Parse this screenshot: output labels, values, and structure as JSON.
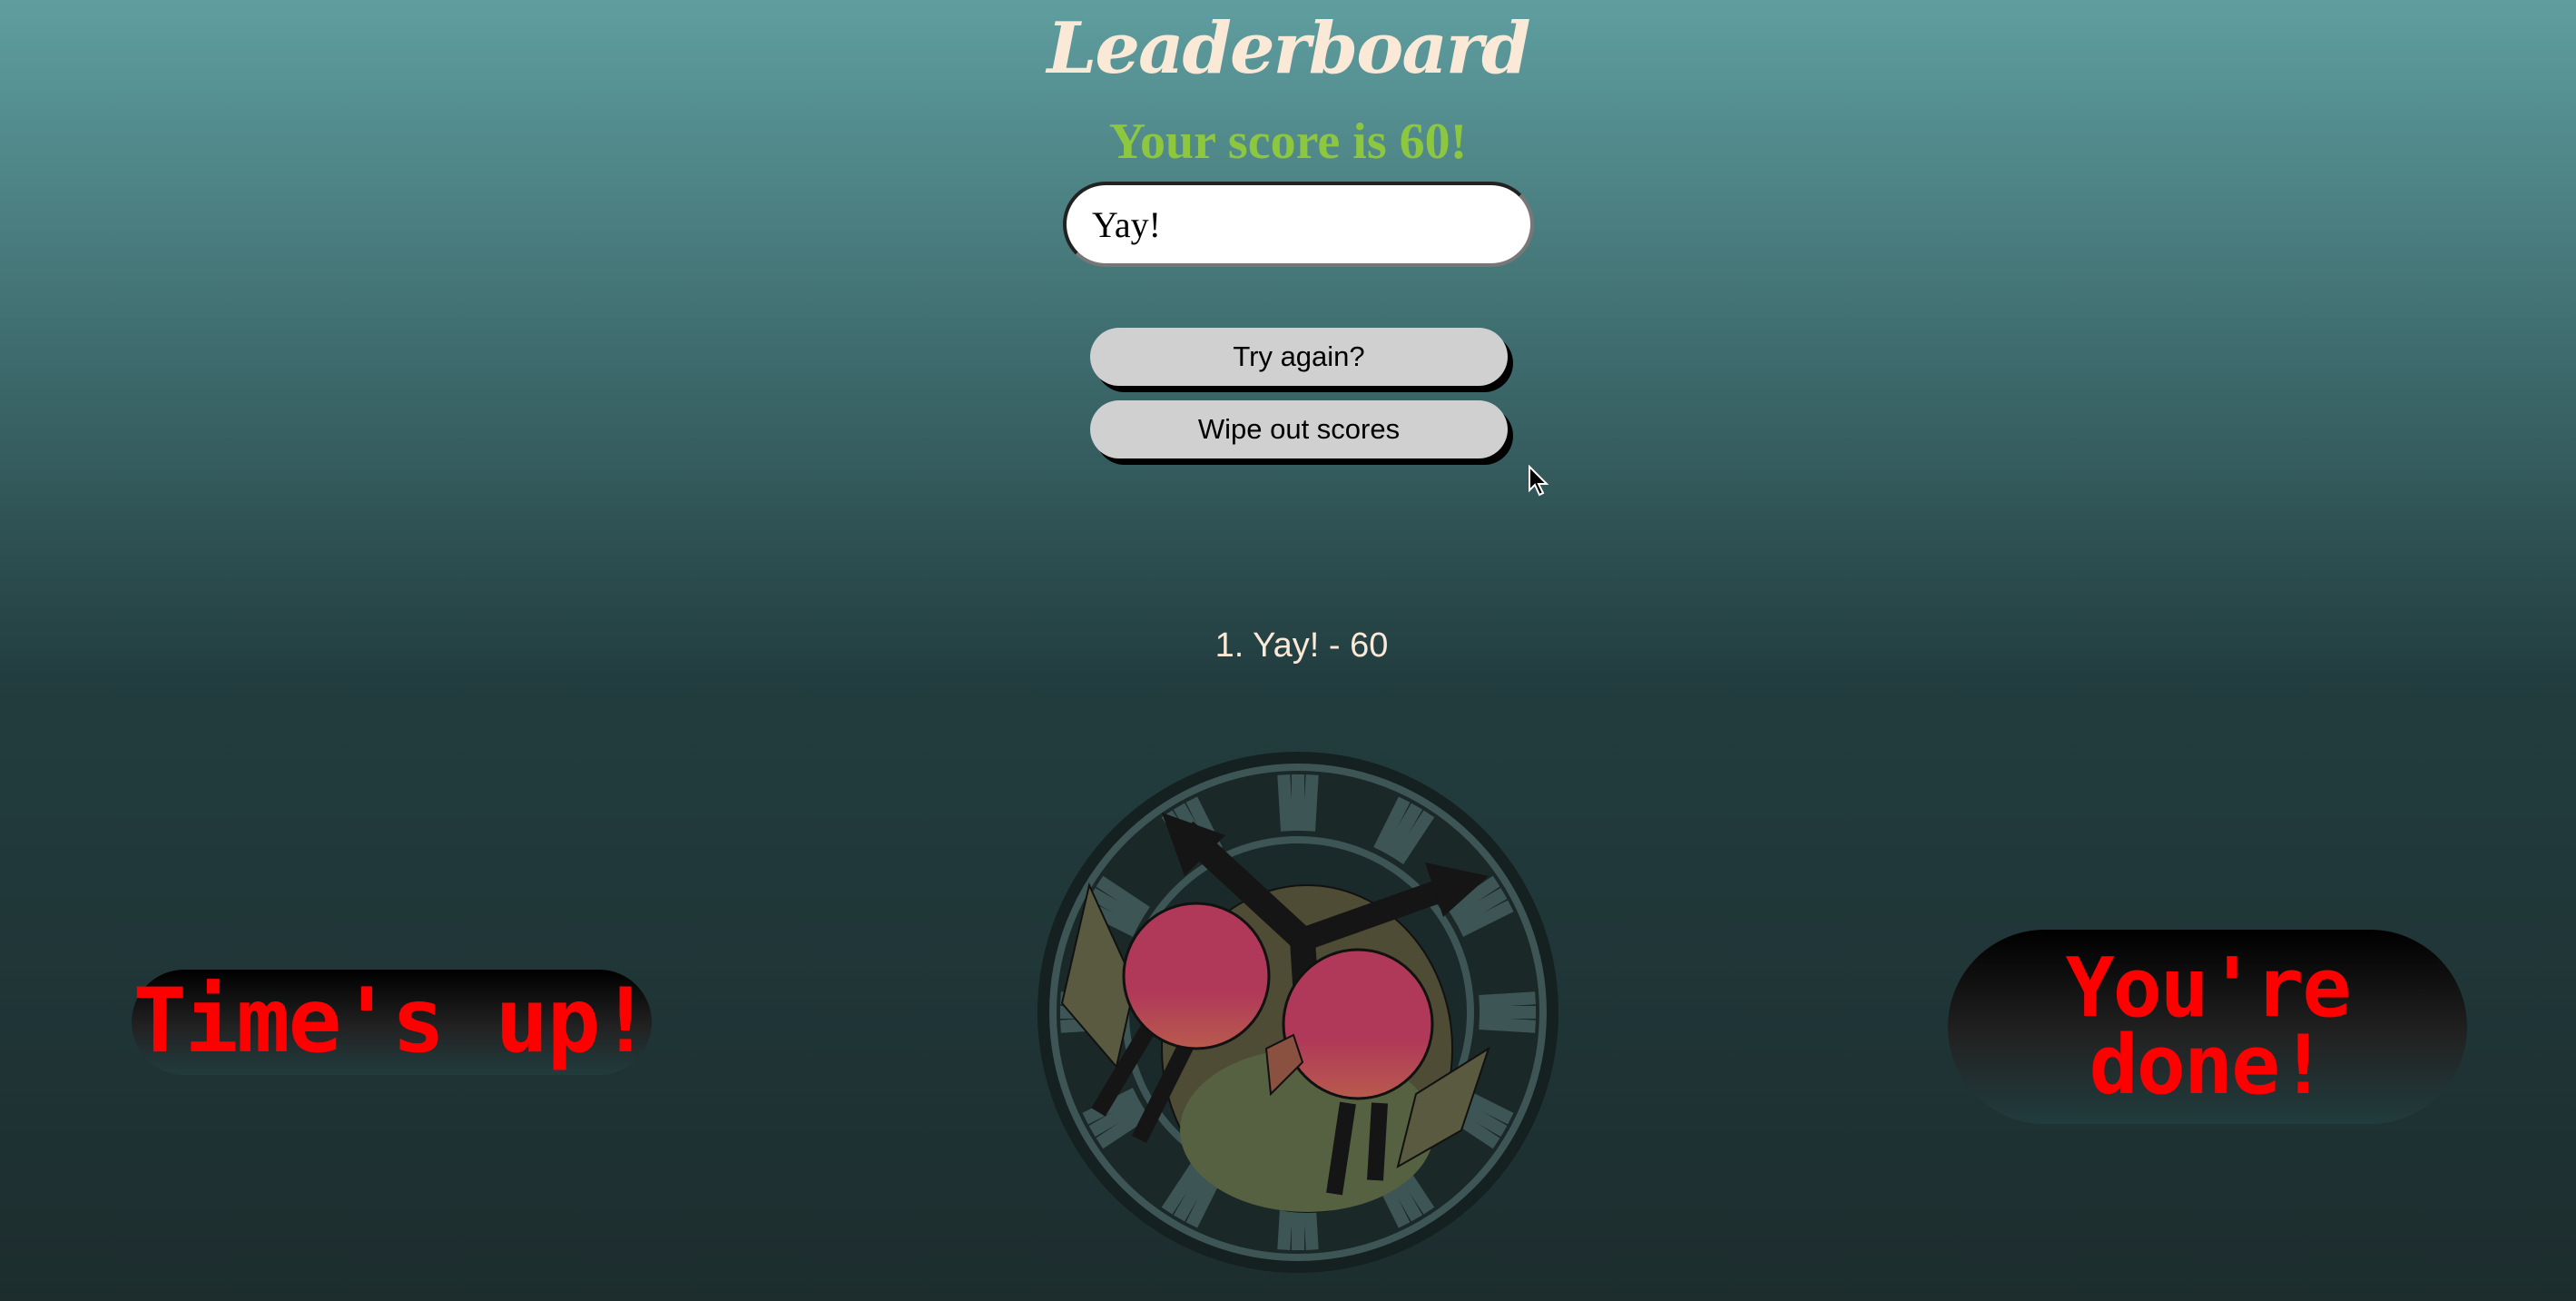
{
  "title": "Leaderboard",
  "score_message": "Your score is 60!",
  "name_input": {
    "value": "Yay!"
  },
  "buttons": {
    "try_again": "Try again?",
    "wipe_scores": "Wipe out scores"
  },
  "leaderboard": [
    {
      "rank": 1,
      "name": "Yay!",
      "score": 60,
      "text": "1. Yay! - 60"
    }
  ],
  "banners": {
    "left": "Time's up!",
    "right": "You're done!"
  },
  "colors": {
    "score": "#8dc63f",
    "title": "#fbe9d7",
    "banner_text": "#ff0000",
    "eyes": "#b03858"
  },
  "icons": {
    "clock": "owl-clock-icon",
    "cursor": "mouse-cursor-icon"
  }
}
